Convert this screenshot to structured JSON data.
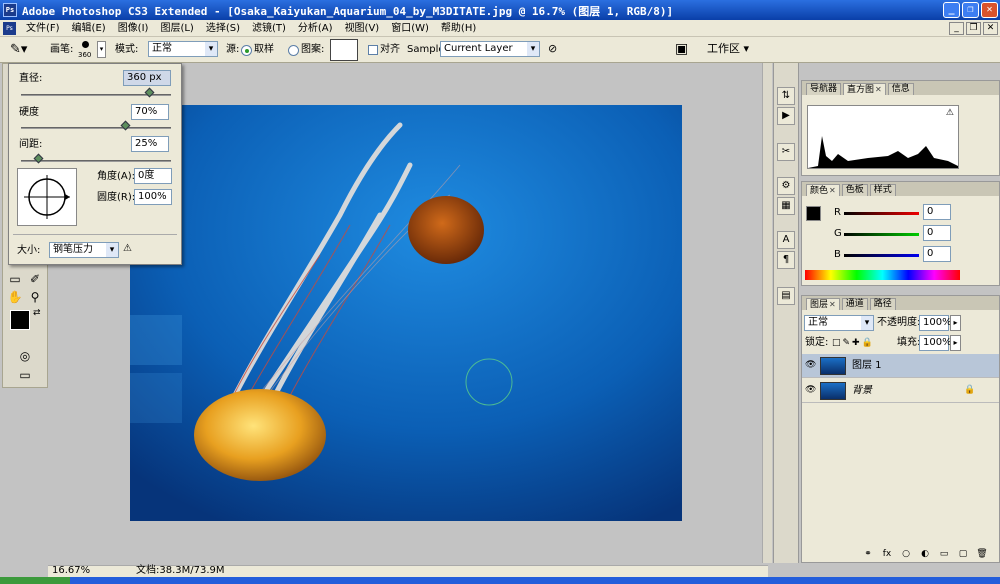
{
  "window": {
    "title": "Adobe Photoshop CS3 Extended - [Osaka_Kaiyukan_Aquarium_04_by_M3DITATE.jpg @ 16.7% (图层 1, RGB/8)]",
    "app_icon": "Ps",
    "buttons": [
      "_",
      "❐",
      "✕"
    ]
  },
  "menu": {
    "items": [
      "文件(F)",
      "编辑(E)",
      "图像(I)",
      "图层(L)",
      "选择(S)",
      "滤镜(T)",
      "分析(A)",
      "视图(V)",
      "窗口(W)",
      "帮助(H)"
    ],
    "mdi_buttons": [
      "_",
      "❐",
      "✕"
    ]
  },
  "options": {
    "brush_label": "画笔:",
    "brush_size": "360",
    "mode_label": "模式:",
    "mode_value": "正常",
    "source_label": "源:",
    "sampled_label": "取样",
    "pattern_label": "图案:",
    "aligned_label": "对齐",
    "sample_label": "Sample:",
    "sample_value": "Current Layer",
    "workspace_label": "工作区 ▾"
  },
  "brush_popup": {
    "diameter_label": "直径:",
    "diameter_value": "360 px",
    "diameter_level": 0.86,
    "hardness_label": "硬度",
    "hardness_value": "70%",
    "hardness_level": 0.7,
    "spacing_label": "间距:",
    "spacing_value": "25%",
    "spacing_level": 0.12,
    "angle_label": "角度(A):",
    "angle_value": "0度",
    "roundness_label": "圆度(R):",
    "roundness_value": "100%",
    "size_label": "大小:",
    "size_value": "钢笔压力"
  },
  "status": {
    "zoom": "16.67%",
    "doc_info": "文档:38.3M/73.9M"
  },
  "panels": {
    "navigator": {
      "tabs": [
        "导航器",
        "直方图",
        "信息"
      ],
      "active": 1
    },
    "color": {
      "tabs": [
        "颜色",
        "色板",
        "样式"
      ],
      "r_label": "R",
      "g_label": "G",
      "b_label": "B",
      "r": "0",
      "g": "0",
      "b": "0"
    },
    "layers": {
      "tabs": [
        "图层",
        "通道",
        "路径"
      ],
      "blend_mode": "正常",
      "opacity_label": "不透明度:",
      "opacity": "100%",
      "lock_label": "锁定:",
      "fill_label": "填充:",
      "fill": "100%",
      "layers": [
        {
          "name": "图层 1",
          "selected": true
        },
        {
          "name": "背景",
          "selected": false
        }
      ],
      "footer_icons": [
        "fx",
        "○",
        "◐",
        "▭",
        "▢",
        "🗑"
      ]
    }
  },
  "colors": {
    "title_bar": "#1550c8",
    "canvas_bg": "#0b62b8",
    "jelly_orange": "#e8a020",
    "panel_bg": "#ece9d8"
  }
}
